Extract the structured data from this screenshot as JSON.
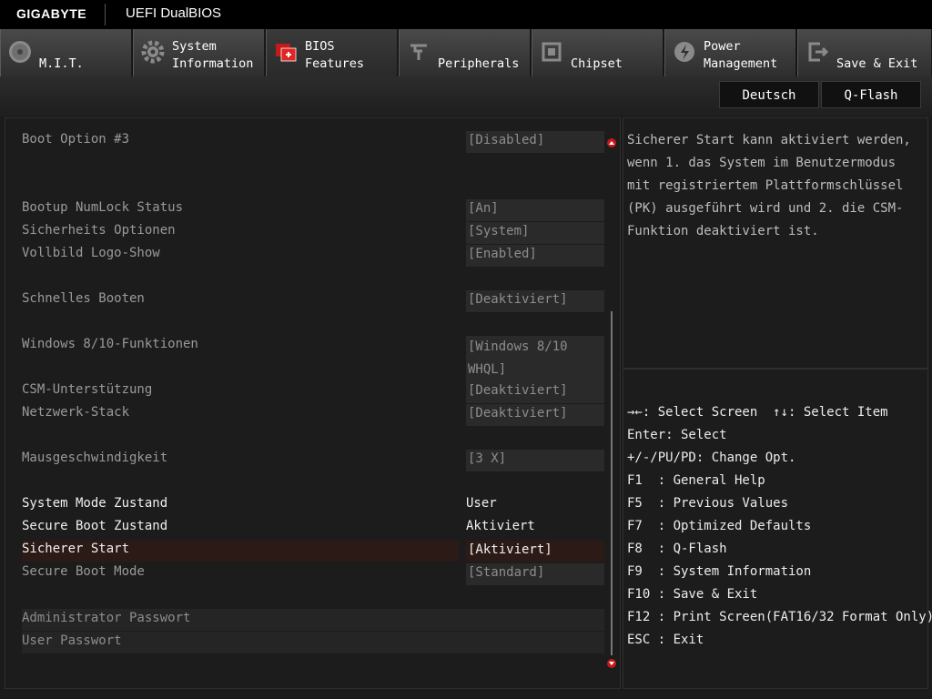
{
  "header": {
    "brand": "GIGABYTE",
    "product": "UEFI DualBIOS"
  },
  "tabs": [
    {
      "line1": "",
      "line2": "M.I.T.",
      "icon": "disc-icon"
    },
    {
      "line1": "System",
      "line2": "Information",
      "icon": "gear-icon"
    },
    {
      "line1": "BIOS",
      "line2": "Features",
      "icon": "bios-chip-icon"
    },
    {
      "line1": "",
      "line2": "Peripherals",
      "icon": "peripherals-icon"
    },
    {
      "line1": "",
      "line2": "Chipset",
      "icon": "chipset-icon"
    },
    {
      "line1": "Power",
      "line2": "Management",
      "icon": "power-icon"
    },
    {
      "line1": "",
      "line2": "Save & Exit",
      "icon": "exit-icon"
    }
  ],
  "active_tab": "BIOS Features",
  "subbar": {
    "lang_button": "Deutsch",
    "qflash_button": "Q-Flash"
  },
  "settings": {
    "boot3": {
      "label": "Boot Option #3",
      "value": "[Disabled]"
    },
    "numlock": {
      "label": "Bootup NumLock Status",
      "value": "[An]"
    },
    "security": {
      "label": "Sicherheits Optionen",
      "value": "[System]"
    },
    "logo": {
      "label": "Vollbild Logo-Show",
      "value": "[Enabled]"
    },
    "fastboot": {
      "label": "Schnelles Booten",
      "value": "[Deaktiviert]"
    },
    "win810": {
      "label": "Windows 8/10-Funktionen",
      "value": "[Windows 8/10 WHQL]"
    },
    "csm": {
      "label": "CSM-Unterstützung",
      "value": "[Deaktiviert]"
    },
    "netstack": {
      "label": "Netzwerk-Stack",
      "value": "[Deaktiviert]"
    },
    "mouse": {
      "label": "Mausgeschwindigkeit",
      "value": "[3 X]"
    },
    "sysmode": {
      "label": "System Mode Zustand",
      "value": "User"
    },
    "sbstate": {
      "label": "Secure Boot Zustand",
      "value": "Aktiviert"
    },
    "securestart": {
      "label": "Sicherer Start",
      "value": "[Aktiviert]"
    },
    "sbmode": {
      "label": "Secure Boot Mode",
      "value": "[Standard]"
    },
    "adminpw": {
      "label": "Administrator Passwort"
    },
    "userpw": {
      "label": "User Passwort"
    }
  },
  "help_text": "Sicherer Start kann aktiviert werden, wenn 1. das System im Benutzermodus mit registriertem Plattformschlüssel (PK) ausgeführt wird und 2. die CSM-Funktion deaktiviert ist.",
  "keys": [
    "→←: Select Screen  ↑↓: Select Item",
    "Enter: Select",
    "+/-/PU/PD: Change Opt.",
    "F1  : General Help",
    "F5  : Previous Values",
    "F7  : Optimized Defaults",
    "F8  : Q-Flash",
    "F9  : System Information",
    "F10 : Save & Exit",
    "F12 : Print Screen(FAT16/32 Format Only)",
    "ESC : Exit"
  ],
  "colors": {
    "accent": "#c31a1a",
    "selection": "#2c1a16"
  }
}
